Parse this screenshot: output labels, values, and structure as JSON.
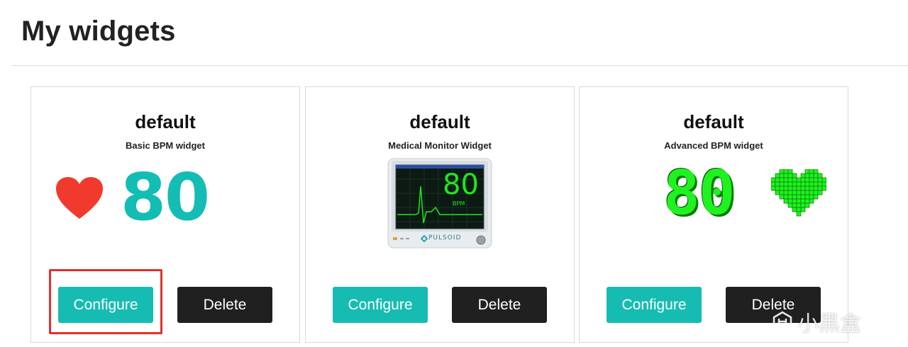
{
  "page": {
    "title": "My widgets"
  },
  "widgets": [
    {
      "name": "default",
      "type": "Basic BPM widget",
      "preview_bpm": "80",
      "configure_label": "Configure",
      "delete_label": "Delete",
      "accent_color": "#16bcb1",
      "heart_color": "#f03a2e"
    },
    {
      "name": "default",
      "type": "Medical Monitor Widget",
      "preview_bpm": "80",
      "preview_unit": "BPM",
      "brand": "PULSOID",
      "configure_label": "Configure",
      "delete_label": "Delete"
    },
    {
      "name": "default",
      "type": "Advanced BPM widget",
      "preview_bpm": "80",
      "configure_label": "Configure",
      "delete_label": "Delete",
      "pixel_color": "#1ff31f"
    }
  ],
  "watermark": {
    "text": "小黑盒"
  }
}
